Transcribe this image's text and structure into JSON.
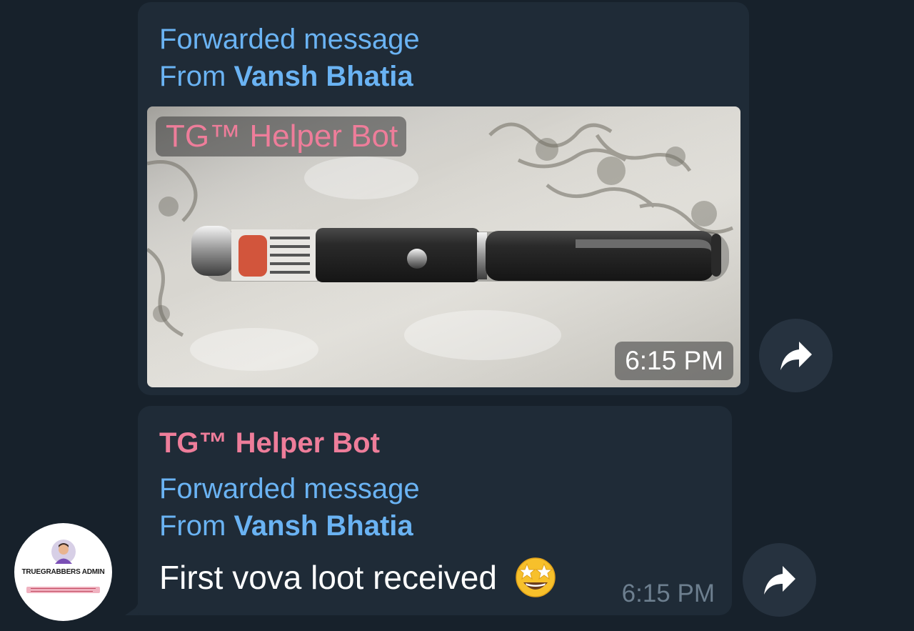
{
  "messages": [
    {
      "forward_prefix": "Forwarded message",
      "from_prefix": "From",
      "from_name": "Vansh Bhatia",
      "photo_overlay_name": "TG™ Helper Bot",
      "time": "6:15 PM"
    },
    {
      "sender_name": "TG™ Helper Bot",
      "forward_prefix": "Forwarded message",
      "from_prefix": "From",
      "from_name": "Vansh Bhatia",
      "text": "First vova loot received",
      "emoji": "star-struck-emoji",
      "time": "6:15 PM"
    }
  ],
  "avatar": {
    "label": "TRUEGRABBERS ADMIN"
  },
  "icons": {
    "share": "share-arrow-icon"
  },
  "colors": {
    "background": "#17212b",
    "bubble": "#1f2b37",
    "link_blue": "#6ab3f3",
    "sender_pink": "#ee7d9a",
    "time_gray": "#6d7f8f",
    "share_button": "#26323f"
  }
}
